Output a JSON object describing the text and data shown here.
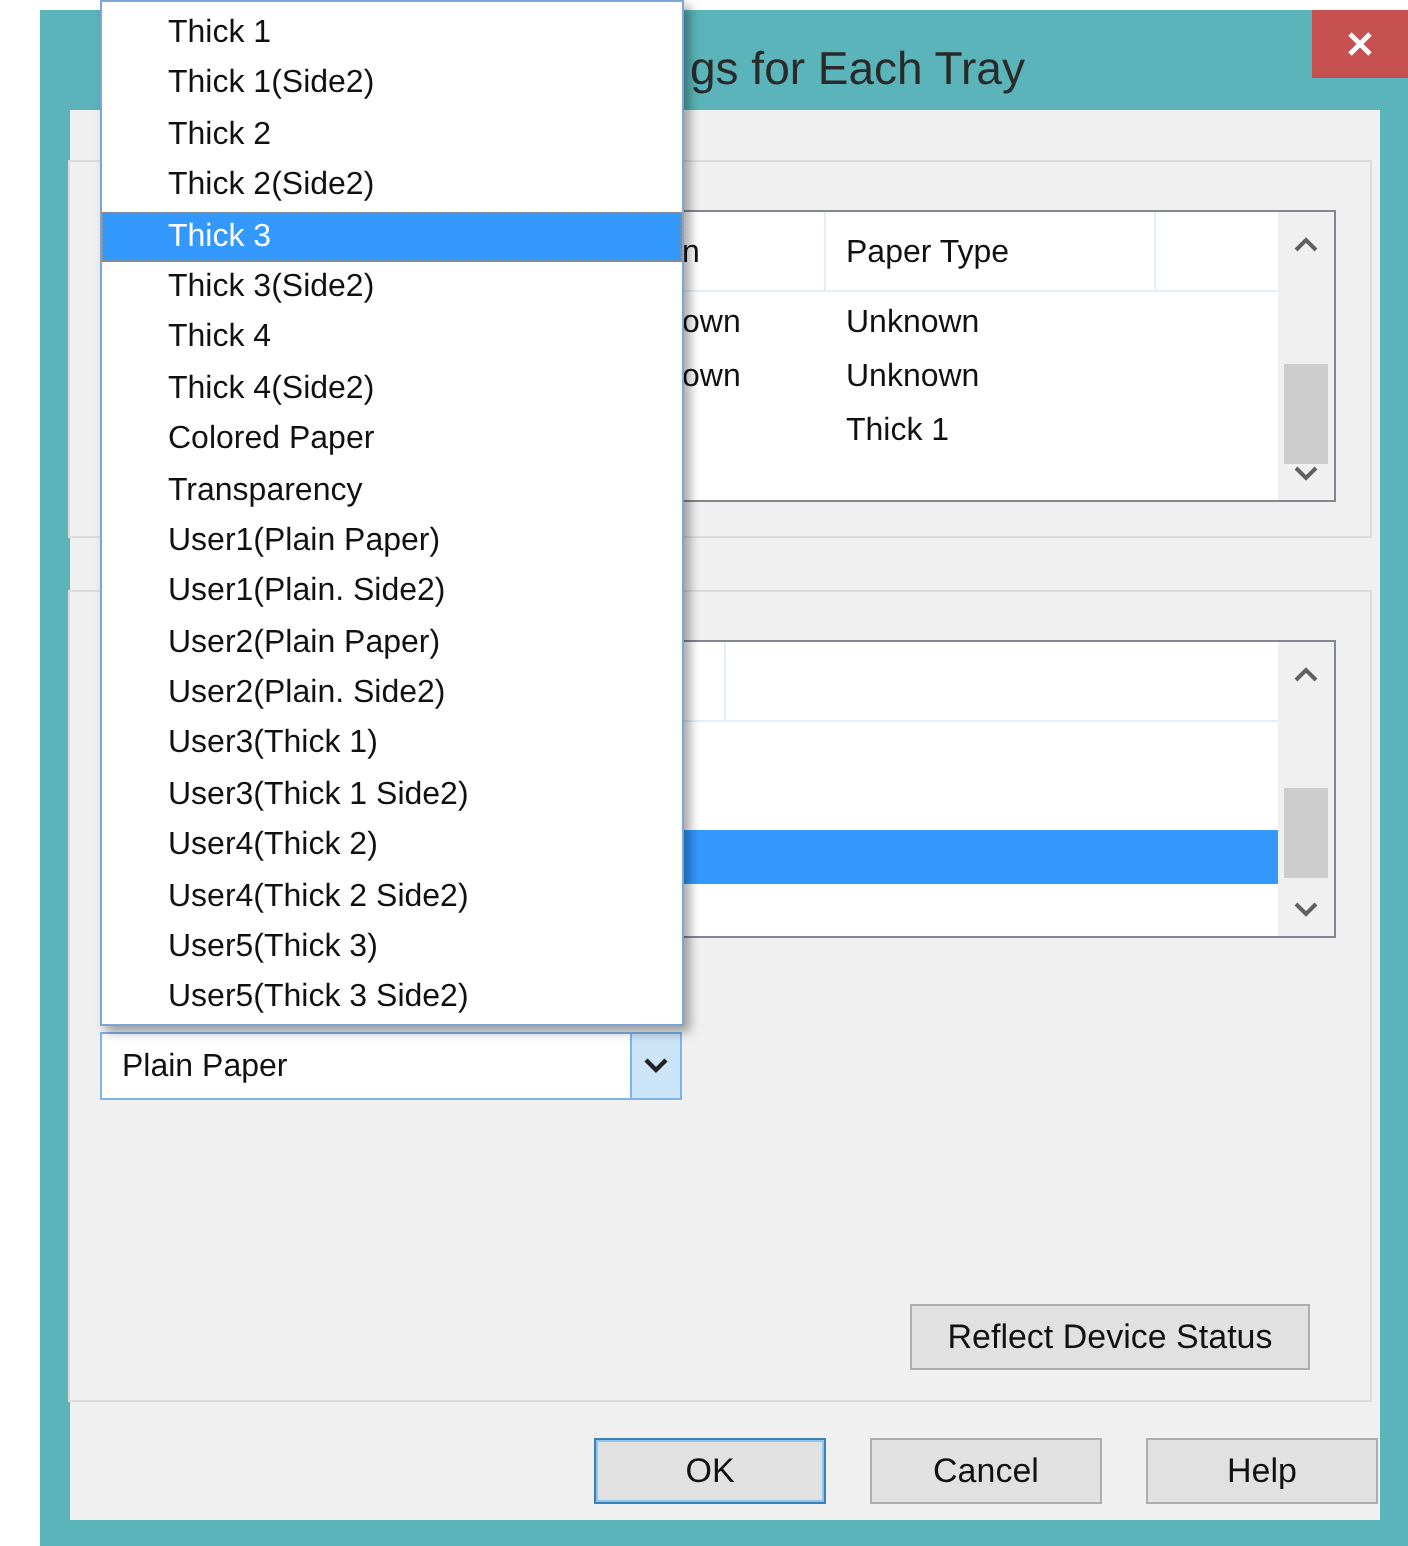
{
  "window": {
    "title": "gs for Each Tray"
  },
  "tray_list": {
    "columns": [
      "n",
      "Paper Type"
    ],
    "rows": [
      {
        "column_1": "own",
        "paper_type": "Unknown"
      },
      {
        "column_1": "own",
        "paper_type": "Unknown"
      },
      {
        "paper_type": "Thick 1"
      }
    ]
  },
  "second_list": {
    "rows": [
      {
        "selected": true
      }
    ]
  },
  "paper_type_combo": {
    "value": "Plain Paper",
    "expanded": true,
    "options": [
      {
        "label": "Thick 1",
        "selected": false
      },
      {
        "label": "Thick 1(Side2)",
        "selected": false
      },
      {
        "label": "Thick 2",
        "selected": false
      },
      {
        "label": "Thick 2(Side2)",
        "selected": false
      },
      {
        "label": "Thick 3",
        "selected": true
      },
      {
        "label": "Thick 3(Side2)",
        "selected": false
      },
      {
        "label": "Thick 4",
        "selected": false
      },
      {
        "label": "Thick 4(Side2)",
        "selected": false
      },
      {
        "label": "Colored Paper",
        "selected": false
      },
      {
        "label": "Transparency",
        "selected": false
      },
      {
        "label": "User1(Plain Paper)",
        "selected": false
      },
      {
        "label": "User1(Plain. Side2)",
        "selected": false
      },
      {
        "label": "User2(Plain Paper)",
        "selected": false
      },
      {
        "label": "User2(Plain. Side2)",
        "selected": false
      },
      {
        "label": "User3(Thick 1)",
        "selected": false
      },
      {
        "label": "User3(Thick 1 Side2)",
        "selected": false
      },
      {
        "label": "User4(Thick 2)",
        "selected": false
      },
      {
        "label": "User4(Thick 2 Side2)",
        "selected": false
      },
      {
        "label": "User5(Thick 3)",
        "selected": false
      },
      {
        "label": "User5(Thick 3 Side2)",
        "selected": false
      }
    ]
  },
  "reflect_button": {
    "label": "Reflect Device Status"
  },
  "buttons": [
    {
      "label": "OK",
      "default": true
    },
    {
      "label": "Cancel",
      "default": false
    },
    {
      "label": "Help",
      "default": false
    }
  ]
}
